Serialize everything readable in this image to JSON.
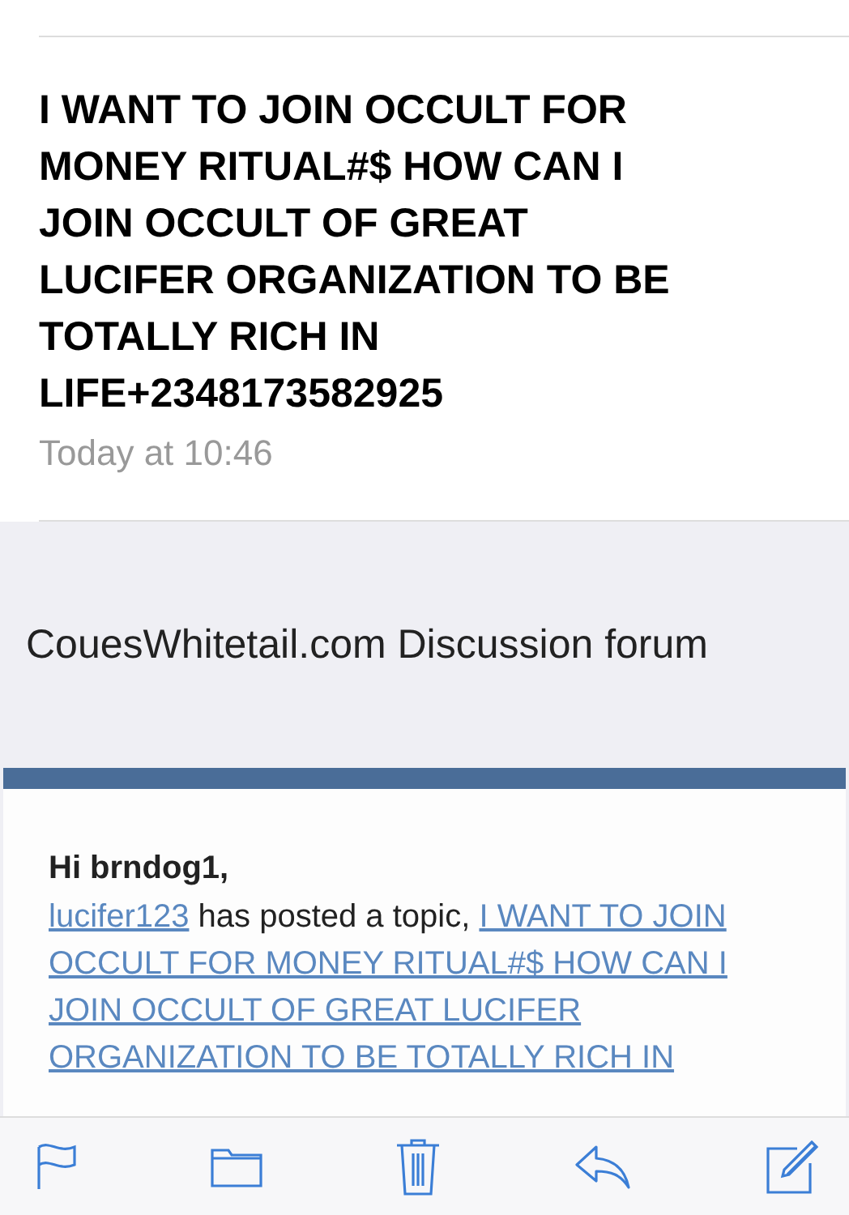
{
  "message": {
    "subject": "I WANT TO JOIN OCCULT FOR MONEY RITUAL#$ HOW CAN I JOIN OCCULT OF GREAT LUCIFER ORGANIZATION TO BE TOTALLY RICH IN LIFE+2348173582925",
    "date": "Today at 10:46"
  },
  "email_body": {
    "forum_name": "CouesWhitetail.com Discussion forum",
    "greeting": "Hi brndog1,",
    "poster_link": "lucifer123",
    "text": " has posted a topic, ",
    "topic_link_lines": [
      "I WANT TO JOIN",
      "OCCULT FOR MONEY RITUAL#$ HOW CAN I",
      "JOIN OCCULT OF GREAT LUCIFER",
      "ORGANIZATION TO BE TOTALLY RICH IN"
    ]
  },
  "toolbar": [
    {
      "kind": "flag"
    },
    {
      "kind": "folder"
    },
    {
      "kind": "trash"
    },
    {
      "kind": "reply"
    },
    {
      "kind": "compose"
    }
  ]
}
